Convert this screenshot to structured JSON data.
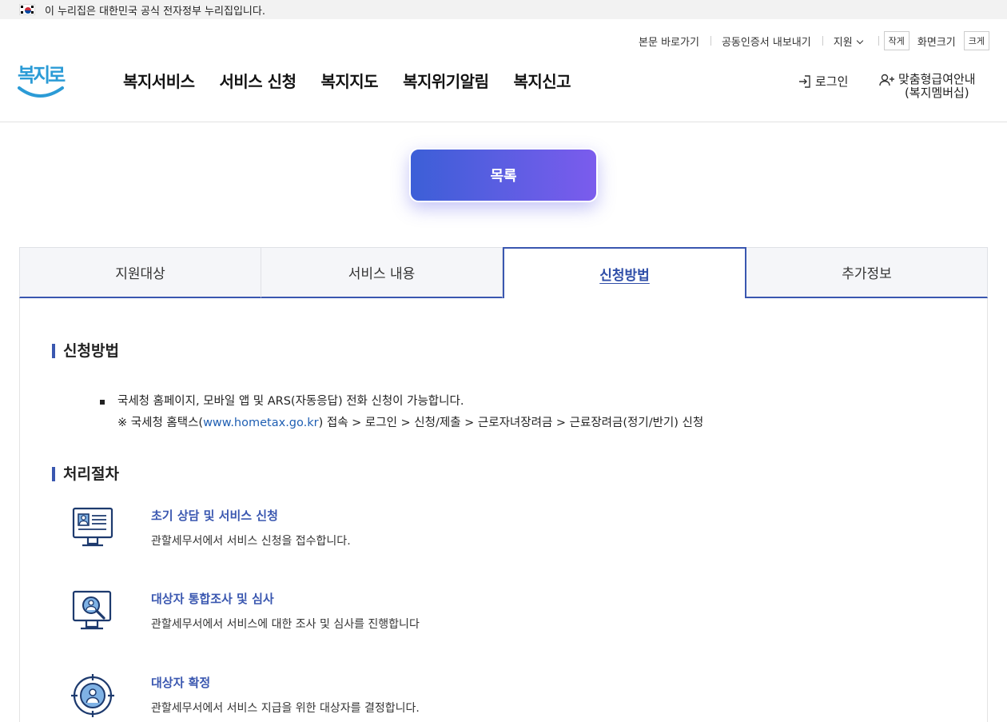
{
  "gov_banner": {
    "text": "이 누리집은 대한민국 공식 전자정부 누리집입니다."
  },
  "util": {
    "skip_link": "본문 바로가기",
    "cert_export": "공동인증서 내보내기",
    "support": "지원",
    "font_small": "작게",
    "font_label": "화면크기",
    "font_large": "크게"
  },
  "logo": {
    "text": "복지로",
    "color": "#2b9bd6"
  },
  "gnb": [
    "복지서비스",
    "서비스 신청",
    "복지지도",
    "복지위기알림",
    "복지신고"
  ],
  "header": {
    "login": "로그인",
    "member_line1": "맞춤형급여안내",
    "member_line2": "(복지멤버십)"
  },
  "list_button": "목록",
  "tabs": [
    {
      "label": "지원대상",
      "active": false
    },
    {
      "label": "서비스 내용",
      "active": false
    },
    {
      "label": "신청방법",
      "active": true
    },
    {
      "label": "추가정보",
      "active": false
    }
  ],
  "apply": {
    "title": "신청방법",
    "bullet": "국세청 홈페이지, 모바일 앱 및 ARS(자동응답) 전화 신청이 가능합니다.",
    "note_prefix": "※ 국세청 홈택스(",
    "note_url": "www.hometax.go.kr",
    "note_suffix": ") 접속 > 로그인 > 신청/제출 > 근로자녀장려금 > 근료장려금(정기/반기) 신청"
  },
  "process": {
    "title": "처리절차",
    "steps": [
      {
        "icon": "computer-profile-icon",
        "title": "초기 상담 및 서비스 신청",
        "desc": "관할세무서에서 서비스 신청을 접수합니다."
      },
      {
        "icon": "monitor-search-icon",
        "title": "대상자 통합조사 및 심사",
        "desc": "관할세무서에서 서비스에 대한 조사 및 심사를 진행합니다"
      },
      {
        "icon": "target-person-icon",
        "title": "대상자 확정",
        "desc": "관할세무서에서 서비스 지급을 위한 대상자를 결정합니다."
      }
    ]
  },
  "colors": {
    "accent": "#3a57b0",
    "link": "#1f5fb3",
    "button_from": "#3c5fd7",
    "button_to": "#7b5ced"
  }
}
